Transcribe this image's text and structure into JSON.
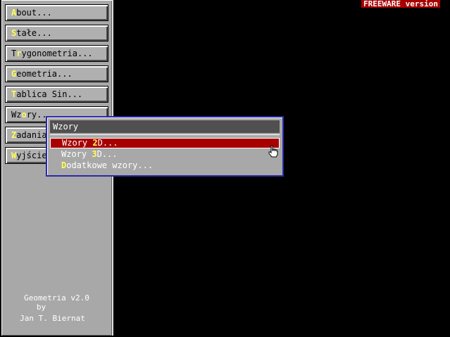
{
  "banner": "FREEWARE version",
  "sidebar": {
    "buttons": [
      {
        "hot": "A",
        "rest": "bout..."
      },
      {
        "hot": "S",
        "rest": "tałe..."
      },
      {
        "pre": "T",
        "hot": "r",
        "rest": "ygonometria..."
      },
      {
        "hot": "G",
        "rest": "eometria..."
      },
      {
        "hot": "T",
        "rest": "ablica Sin..."
      },
      {
        "pre": "Wz",
        "hot": "o",
        "rest": "ry..."
      },
      {
        "hot": "Z",
        "rest": "adania"
      },
      {
        "hot": "W",
        "rest": "yjście"
      }
    ],
    "credits": [
      "Geometria v2.0",
      "by",
      "Jan T. Biernat"
    ]
  },
  "popup": {
    "title": "Wzory",
    "items": [
      {
        "pre": "Wzory ",
        "hot": "2",
        "rest": "D...",
        "selected": true
      },
      {
        "pre": "Wzory ",
        "hot": "3",
        "rest": "D...",
        "selected": false
      },
      {
        "pre": "",
        "hot": "D",
        "rest": "odatkowe wzory...",
        "selected": false
      }
    ]
  },
  "colors": {
    "selection": "#a80000",
    "hotkey": "#ffff55",
    "popup_border": "#2a2aa8"
  },
  "icons": {
    "cursor": "hand-pointer-icon"
  }
}
